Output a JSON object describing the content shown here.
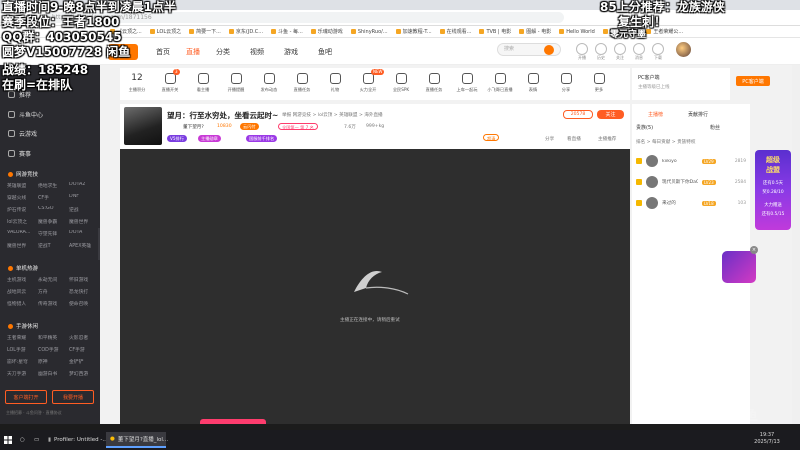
{
  "browser": {
    "url": "https://www.douyu.com/1871156",
    "bookmarks": [
      "《云顶之...",
      "LOL云顶之",
      "简要一下...",
      "京东(JD.C...",
      "斗鱼 - 每...",
      "乐魂动游戏",
      "ShinyRuo/...",
      "加速教程-T...",
      "在线观看...",
      "TVB | 电影",
      "图解 - 电影",
      "Hello World",
      "(Super)电影",
      "王者荣耀公..."
    ]
  },
  "header": {
    "logo": "斗鱼",
    "nav": [
      "首页",
      "直播",
      "分类",
      "视频",
      "游戏",
      "鱼吧"
    ],
    "search_placeholder": "搜索",
    "icons": [
      "开播",
      "历史",
      "关注",
      "消息",
      "下载",
      "邮箱"
    ]
  },
  "overlay": {
    "line1": "直播时间9-晚8点半到凌晨1点半",
    "line2": "赛季段位：王者1800",
    "line3": "QQ群：403050545",
    "line4": "圆梦V15007728 闲鱼",
    "line5": "战绩：185248",
    "line6": "在刷=在排队",
    "right1": "85上分推荐：龙族游侠",
    "right2": "复生刺！",
    "right3": "零元守墨"
  },
  "sidebar": {
    "main": [
      {
        "label": "推荐"
      },
      {
        "label": "斗鱼中心"
      },
      {
        "label": "云游戏"
      },
      {
        "label": "赛事"
      }
    ],
    "sections": [
      {
        "title": "网游竞技",
        "items": [
          "英雄联盟",
          "绝地求生",
          "DOTA2",
          "穿越火线",
          "CF手",
          "DNF",
          "炉石传说",
          "CS:GO",
          "逆战",
          "lol云顶之",
          "魔兽争霸",
          "魔兽世界",
          "VALORA...",
          "守望先锋",
          "DOTA",
          "魔兽世界",
          "逆战T",
          "APEX英雄"
        ]
      },
      {
        "title": "单机热游",
        "items": [
          "主机游戏",
          "永劫无间",
          "怀旧游戏",
          "战地风云",
          "方舟",
          "恐龙快打",
          "怪物猎人",
          "传奇游戏",
          "使命召唤"
        ]
      },
      {
        "title": "手游休闲",
        "items": [
          "王者荣耀",
          "和平精英",
          "火影忍者",
          "LOL手游",
          "COD手游",
          "CF手游",
          "崩坏:星穹",
          "原神",
          "金铲铲",
          "天刀手游",
          "幽游白书",
          "梦幻西游"
        ]
      }
    ],
    "btn_client": "客户端打开",
    "btn_live": "我要开播",
    "footer": "主播招募 · 斗鱼问答 · 直播协议"
  },
  "categories": [
    {
      "label": "主播积分",
      "value": "12"
    },
    {
      "label": "直播开关",
      "badge": "3"
    },
    {
      "label": "看主播"
    },
    {
      "label": "开播提醒"
    },
    {
      "label": "发布动态"
    },
    {
      "label": "直播任务"
    },
    {
      "label": "礼物"
    },
    {
      "label": "火力全开",
      "badge": "NEW"
    },
    {
      "label": "全民SPK"
    },
    {
      "label": "直播任务"
    },
    {
      "label": "上车一起玩"
    },
    {
      "label": "小飞哥已直播"
    },
    {
      "label": "表情"
    },
    {
      "label": "分享"
    },
    {
      "label": "更多"
    }
  ],
  "pc_card": {
    "title": "PC客户端",
    "sub": "主播等级已上线",
    "button": "PC客户端"
  },
  "room": {
    "title": "望月：行至水穷处，坐看云起时~",
    "subtitle": "举报  网游竞技 > lol云顶 > 英雄联盟 > 海外直播",
    "owner": "董下望月?",
    "fans": "10830",
    "hot_tag": "云闪付",
    "tags": [
      "V5排行",
      "主播勋章",
      "国服前千排名"
    ],
    "rank_text": "全国第一 第 7 名",
    "viewers": "7.6万",
    "weight": "999+kg",
    "follow_label": "关注",
    "follow_count": "20578",
    "stats": [
      "分享",
      "看直播",
      "主播推荐"
    ],
    "wifi_tag": "超清"
  },
  "player": {
    "message": "主播正在连接中，请稍后重试"
  },
  "right_panel": {
    "tabs": [
      "主播榜",
      "贡献排行",
      "贵族(5)",
      "粉丝"
    ],
    "sub_title": "本周贡献值排行榜",
    "rank_label": "排名 > 每日贡献 > 贵族特权",
    "rows": [
      {
        "name": "kiikiyo",
        "level": "LV29",
        "num": "2819"
      },
      {
        "name": "现代贝斯下你DaO",
        "level": "LV23",
        "num": "2584"
      },
      {
        "name": "来过的",
        "level": "LV18",
        "num": "103"
      }
    ]
  },
  "promo": {
    "line1": "超级",
    "line2": "战盟",
    "line3": "还有0.5天",
    "line4": "奖0.28/10",
    "line5": "大力赠送",
    "line6": "还有0.5/15"
  },
  "taskbar": {
    "apps": [
      {
        "label": "Profiler: Untitled -..."
      },
      {
        "label": "董下望月?直播_lol..."
      }
    ],
    "time": "19:37",
    "date": "2025/7/13"
  }
}
